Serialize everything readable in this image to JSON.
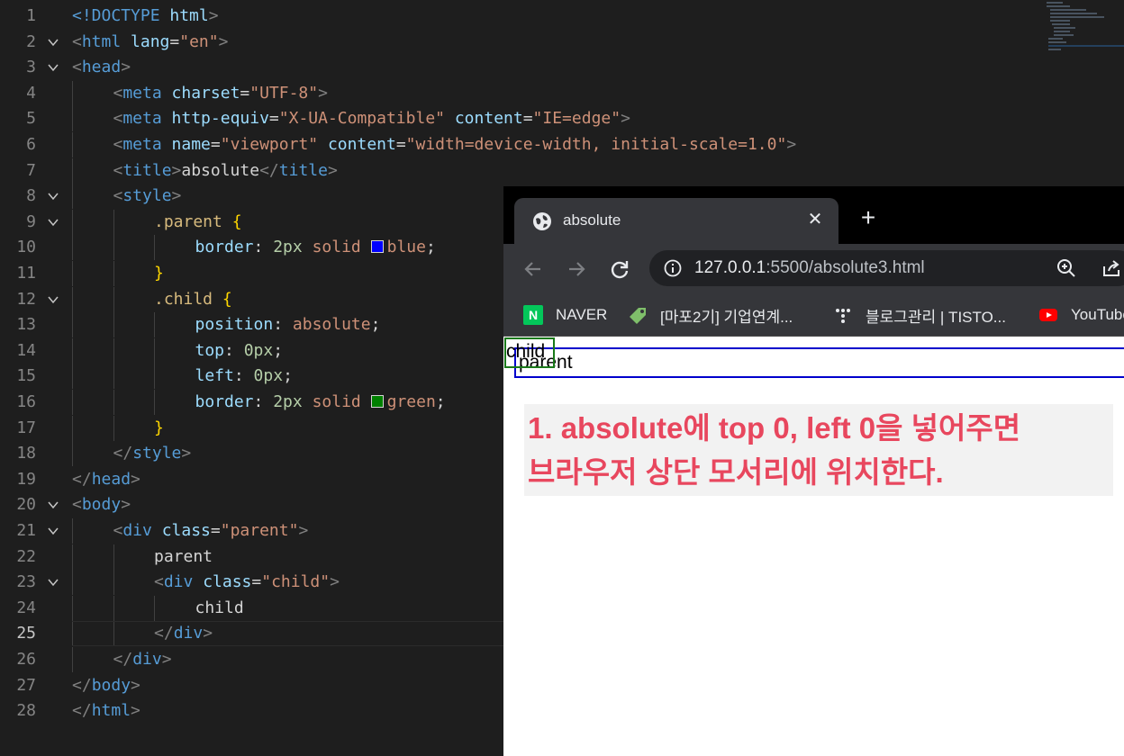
{
  "editor": {
    "lines": [
      {
        "n": "1"
      },
      {
        "n": "2"
      },
      {
        "n": "3"
      },
      {
        "n": "4"
      },
      {
        "n": "5"
      },
      {
        "n": "6"
      },
      {
        "n": "7"
      },
      {
        "n": "8"
      },
      {
        "n": "9"
      },
      {
        "n": "10"
      },
      {
        "n": "11"
      },
      {
        "n": "12"
      },
      {
        "n": "13"
      },
      {
        "n": "14"
      },
      {
        "n": "15"
      },
      {
        "n": "16"
      },
      {
        "n": "17"
      },
      {
        "n": "18"
      },
      {
        "n": "19"
      },
      {
        "n": "20"
      },
      {
        "n": "21"
      },
      {
        "n": "22"
      },
      {
        "n": "23"
      },
      {
        "n": "24"
      },
      {
        "n": "25"
      },
      {
        "n": "26"
      },
      {
        "n": "27"
      },
      {
        "n": "28"
      }
    ],
    "current_line": "25",
    "code": {
      "l1_doctype": "<!DOCTYPE",
      "l1_html": " html",
      "l1_close": ">",
      "l2_tag": "html",
      "l2_attr": "lang",
      "l2_val": "\"en\"",
      "l3_tag": "head",
      "meta": "meta",
      "l4_attr": "charset",
      "l4_val": "\"UTF-8\"",
      "l5_attr1": "http-equiv",
      "l5_val1": "\"X-UA-Compatible\"",
      "l5_attr2": "content",
      "l5_val2": "\"IE=edge\"",
      "l6_attr1": "name",
      "l6_val1": "\"viewport\"",
      "l6_attr2": "content",
      "l6_val2": "\"width=device-width, initial-scale=1.0\"",
      "title_tag": "title",
      "title_text": "absolute",
      "style_tag": "style",
      "sel_parent": ".parent",
      "brace_open": "{",
      "brace_close": "}",
      "prop_border": "border",
      "val_2px": "2px",
      "val_solid": "solid",
      "val_blue": "blue",
      "color_blue": "#0000ff",
      "sel_child": ".child",
      "prop_position": "position",
      "val_absolute": "absolute",
      "prop_top": "top",
      "prop_left": "left",
      "val_0px": "0px",
      "val_green": "green",
      "color_green": "#008000",
      "head_tag": "head",
      "body_tag": "body",
      "div_tag": "div",
      "attr_class": "class",
      "val_parent": "\"parent\"",
      "text_parent": "parent",
      "val_child": "\"child\"",
      "text_child": "child",
      "html_tag": "html"
    }
  },
  "browser": {
    "tab_title": "absolute",
    "tab_close_glyph": "✕",
    "new_tab_glyph": "+",
    "url_host": "127.0.0.1",
    "url_rest": ":5500/absolute3.html",
    "bookmarks": [
      {
        "label": "NAVER",
        "icon": "naver-icon"
      },
      {
        "label": "[마포2기] 기업연계...",
        "icon": "tag-icon"
      },
      {
        "label": "블로그관리 | TISTO...",
        "icon": "tistory-icon"
      },
      {
        "label": "YouTube",
        "icon": "youtube-icon"
      }
    ],
    "naver_letter": "N",
    "page": {
      "parent_text": "parent",
      "child_text": "child",
      "note_line1": "1. absolute에 top 0, left 0을 넣어주면",
      "note_line2": "브라우저 상단 모서리에 위치한다."
    }
  }
}
